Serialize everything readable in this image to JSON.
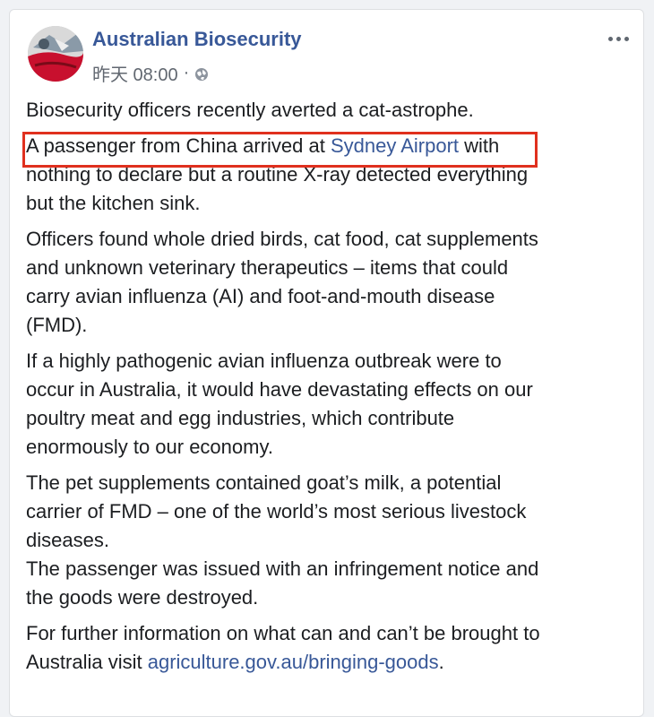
{
  "post": {
    "page_name": "Australian Biosecurity",
    "timestamp": "昨天 08:00",
    "separator": "·",
    "privacy_icon": "globe-icon",
    "more_icon": "more-options-icon",
    "paragraphs": {
      "p1": "Biosecurity officers recently averted a cat-astrophe.",
      "p2_line1_pre": "A passenger from China arrived at ",
      "p2_link": "Sydney Airport",
      "p2_line1_post": " with",
      "p2_line2": "nothing to declare but a routine X-ray detected everything",
      "p2_line3": "but the kitchen sink.",
      "p3_line1": "Officers found whole dried birds, cat food, cat supplements",
      "p3_line2": "and unknown veterinary therapeutics – items that could",
      "p3_line3": "carry avian influenza (AI) and foot-and-mouth disease",
      "p3_line4": "(FMD).",
      "p4_line1": "If a highly pathogenic avian influenza outbreak were to",
      "p4_line2": "occur in Australia, it would have devastating effects on our",
      "p4_line3": "poultry meat and egg industries, which contribute",
      "p4_line4": "enormously to our economy.",
      "p5_line1": "The pet supplements contained goat’s milk, a potential",
      "p5_line2": "carrier of FMD – one of the world’s most serious livestock",
      "p5_line3": "diseases.",
      "p6_line1": "The passenger was issued with an infringement notice and",
      "p6_line2": "the goods were destroyed.",
      "p7_line1": "For further information on what can and can’t be brought to",
      "p7_line2_pre": "Australia visit ",
      "p7_link": "agriculture.gov.au/bringing-goods",
      "p7_line2_post": "."
    }
  },
  "colors": {
    "link": "#385898",
    "text": "#1c1e21",
    "meta": "#616770",
    "highlight_box": "#e0301e"
  }
}
